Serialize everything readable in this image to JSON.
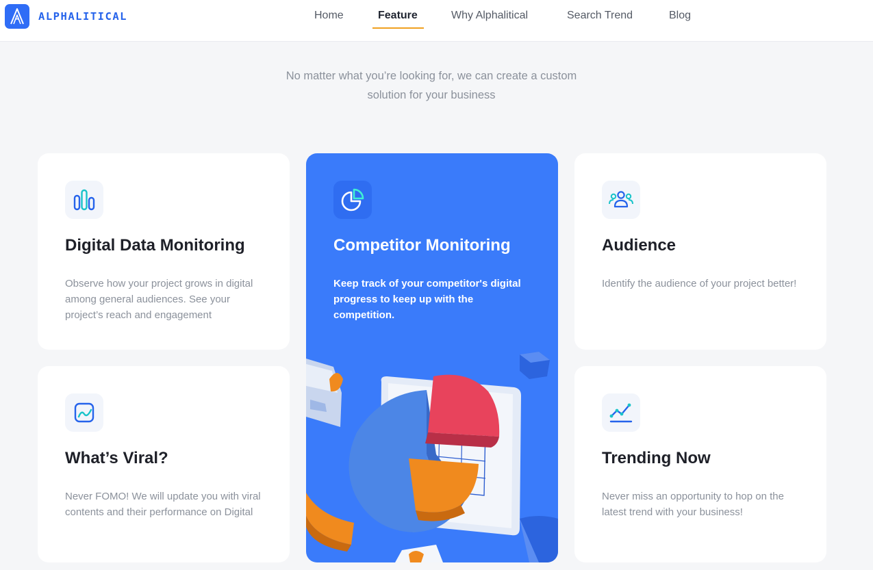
{
  "brand": {
    "name": "ALPHALITICAL",
    "logo_color": "#2f6df6"
  },
  "nav": {
    "items": [
      {
        "label": "Home",
        "active": false
      },
      {
        "label": "Feature",
        "active": true
      },
      {
        "label": "Why Alphalitical",
        "active": false
      },
      {
        "label": "Search Trend",
        "active": false
      },
      {
        "label": "Blog",
        "active": false
      }
    ],
    "active_underline_color": "#f0a020"
  },
  "intro": {
    "line1": "No matter what you’re looking for, we can create a custom",
    "line2": "solution for your business"
  },
  "features": [
    {
      "icon": "bar-chart-icon",
      "title": "Digital Data Monitoring",
      "description": "Observe how your project grows in digital among general audiences. See your project’s reach and engagement"
    },
    {
      "icon": "pie-chart-icon",
      "title": "Competitor Monitoring",
      "description": "Keep track of your competitor's digital progress to keep up with the competition.",
      "featured": true,
      "background": "#3a7bfa"
    },
    {
      "icon": "users-icon",
      "title": "Audience",
      "description": "Identify the audience of your project better!"
    },
    {
      "icon": "chart-window-icon",
      "title": "What’s Viral?",
      "description": "Never FOMO! We will update you with viral contents and their performance on Digital"
    },
    {
      "icon": "trend-line-icon",
      "title": "Trending Now",
      "description": "Never miss an opportunity to hop on the latest trend with your business!"
    }
  ],
  "colors": {
    "accent_blue": "#2563eb",
    "title_dark": "#1e2028",
    "muted_text": "#8b919b",
    "page_bg": "#f5f6f8"
  }
}
